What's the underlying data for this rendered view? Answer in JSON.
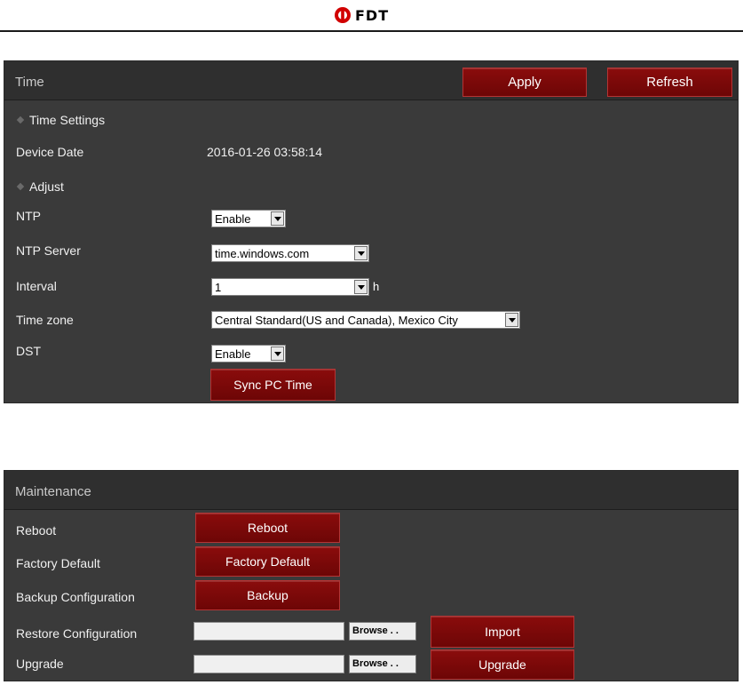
{
  "header": {
    "brand": "FDT"
  },
  "time_panel": {
    "title": "Time",
    "apply_label": "Apply",
    "refresh_label": "Refresh",
    "time_settings_label": "Time Settings",
    "device_date_label": "Device Date",
    "device_date_value": "2016-01-26 03:58:14",
    "adjust_label": "Adjust",
    "ntp_label": "NTP",
    "ntp_value": "Enable",
    "ntp_server_label": "NTP Server",
    "ntp_server_value": "time.windows.com",
    "interval_label": "Interval",
    "interval_value": "1",
    "interval_unit": "h",
    "timezone_label": "Time zone",
    "timezone_value": "Central Standard(US and Canada), Mexico City",
    "dst_label": "DST",
    "dst_value": "Enable",
    "sync_label": "Sync PC Time"
  },
  "maintenance_panel": {
    "title": "Maintenance",
    "reboot_label": "Reboot",
    "reboot_button": "Reboot",
    "factory_label": "Factory Default",
    "factory_button": "Factory Default",
    "backup_label": "Backup Configuration",
    "backup_button": "Backup",
    "restore_label": "Restore Configuration",
    "browse_label": "Browse . .",
    "import_button": "Import",
    "upgrade_label": "Upgrade",
    "upgrade_button": "Upgrade"
  },
  "colors": {
    "accent": "#7a0909",
    "panel_bg": "#3a3a3a",
    "title_bar": "#2f2f2f"
  },
  "icons": {
    "brand_logo": "fdt-logo-icon",
    "section_bullet": "diamond-icon",
    "dropdown": "chevron-down-icon"
  }
}
